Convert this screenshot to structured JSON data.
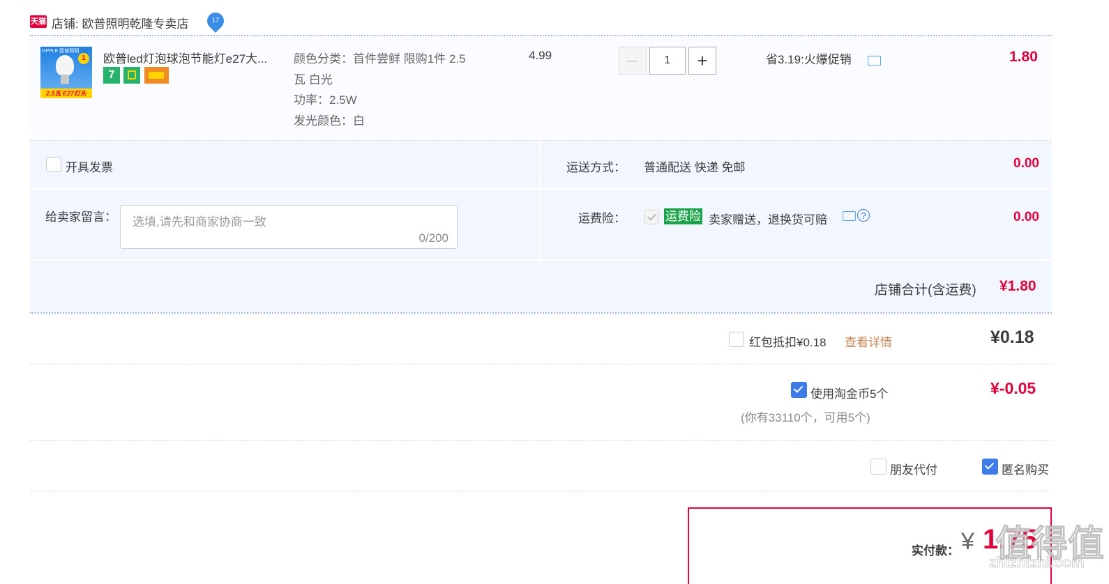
{
  "shop": {
    "badge": "天猫",
    "label": "店铺: 欧普照明乾隆专卖店",
    "level_icon": "water-drop-icon",
    "level_num": "17"
  },
  "product": {
    "thumb_top_text": "OPPLE 欧普照明",
    "thumb_tag": "1",
    "thumb_bottom_text": "2.5瓦 E27灯头",
    "title": "欧普led灯泡球泡节能灯e27大...",
    "spec_lines": [
      "颜色分类：首件尝鲜 限购1件 2.5",
      "瓦 白光",
      "功率：2.5W",
      "发光颜色：白"
    ],
    "unit_price": "4.99",
    "quantity": "1",
    "minus_label": "—",
    "plus_label": "+",
    "promo": "省3.19:火爆促销",
    "subtotal": "1.80",
    "badge_seven": "7"
  },
  "invoice": {
    "label": "开具发票"
  },
  "shipping": {
    "label": "运送方式：",
    "value": "普通配送 快递 免邮",
    "fee": "0.00"
  },
  "message": {
    "label": "给卖家留言：",
    "placeholder": "选填,请先和商家协商一致",
    "counter": "0/200"
  },
  "insurance": {
    "label": "运费险：",
    "tag": "运费险",
    "text": "卖家赠送，退换货可赔",
    "fee": "0.00"
  },
  "shop_total": {
    "label": "店铺合计(含运费)",
    "value": "¥1.80"
  },
  "redpacket": {
    "label": "红包抵扣¥0.18",
    "link": "查看详情",
    "value": "¥0.18"
  },
  "coin": {
    "label": "使用淘金币5个",
    "note": "(你有33110个，可用5个)",
    "value": "¥-0.05"
  },
  "options": {
    "friend_pay": "朋友代付",
    "anonymous": "匿名购买"
  },
  "payment": {
    "label": "实付款：",
    "currency": "¥",
    "amount": "1.75"
  },
  "watermark": {
    "main": "值得值",
    "sub": "zhizhizhi.com"
  },
  "colors": {
    "accent_red": "#e4003a",
    "check_blue": "#3d7ce8",
    "row_bg": "#f2f7ff",
    "tag_green": "#1aa34a"
  }
}
